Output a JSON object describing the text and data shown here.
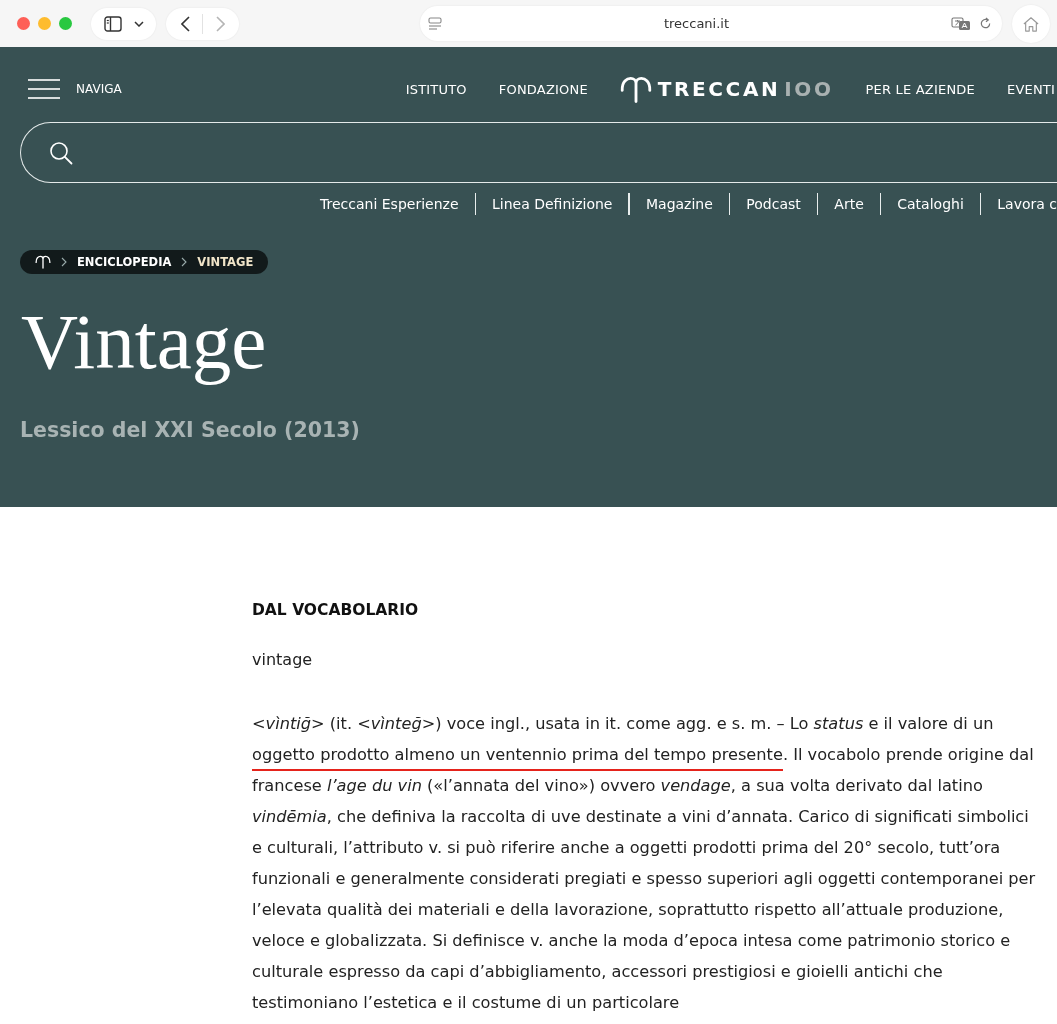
{
  "browser": {
    "address": "treccani.it"
  },
  "header": {
    "menu_label": "NAVIGA",
    "nav_left": [
      "ISTITUTO",
      "FONDAZIONE"
    ],
    "logo": {
      "main": "TRECCAN",
      "accent": "IOO"
    },
    "nav_right": [
      "PER LE AZIENDE",
      "EVENTI"
    ],
    "links": [
      "Treccani Esperienze",
      "Linea Definizione",
      "Magazine",
      "Podcast",
      "Arte",
      "Cataloghi",
      "Lavora c"
    ],
    "breadcrumb": [
      {
        "label": "ENCICLOPEDIA",
        "current": false
      },
      {
        "label": "VINTAGE",
        "current": true
      }
    ],
    "title": "Vintage",
    "subtitle": "Lessico del XXI Secolo (2013)"
  },
  "article": {
    "section_heading": "DAL VOCABOLARIO",
    "headword": "vintage",
    "paragraph": [
      {
        "text": "<*vìntiğ*> (it. <*vìnteğ*>) voce ingl., usata in it. come agg. e s. m. – Lo *status* e il valore di un ",
        "underlined": false
      },
      {
        "text": "oggetto prodotto almeno un ventennio prima del tempo presente",
        "underlined": true
      },
      {
        "text": ". Il vocabolo prende origine dal francese *l’age du vin* («l’annata del vino») ovvero *vendage*, a sua volta derivato dal latino *vindēmia*, che definiva la raccolta di uve destinate a vini d’annata. Carico di significati simbolici e culturali, l’attributo v. si può riferire anche a oggetti prodotti prima del 20° secolo, tutt’ora funzionali e generalmente considerati pregiati e spesso superiori agli oggetti contemporanei per l’elevata qualità dei materiali e della lavorazione, soprattutto rispetto all’attuale produzione, veloce e globalizzata. Si definisce v. anche la moda d’epoca intesa come patrimonio storico e culturale espresso da capi d’abbigliamento, accessori prestigiosi e gioielli antichi che testimoniano l’estetica e il costume di un particolare",
        "underlined": false
      }
    ]
  }
}
